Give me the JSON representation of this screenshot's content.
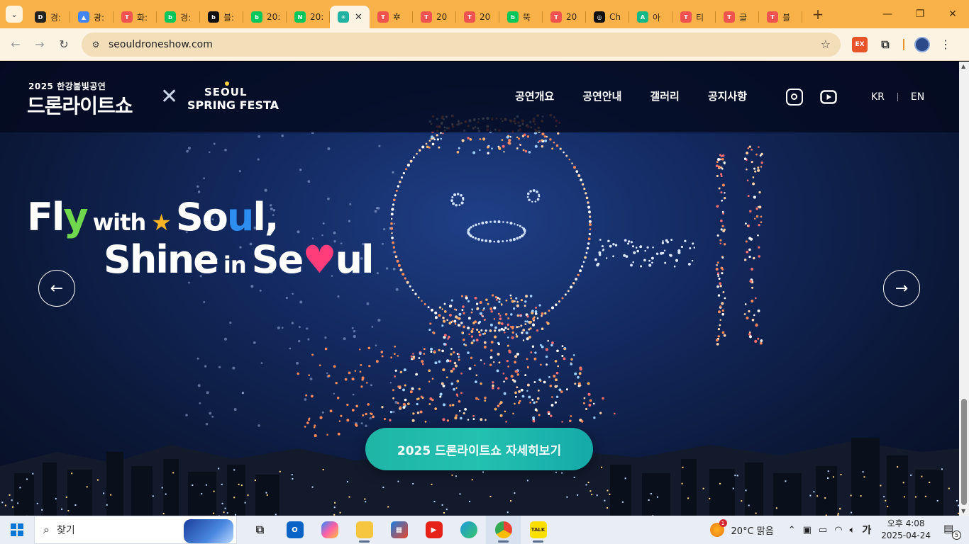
{
  "browser": {
    "tabs": [
      {
        "label": "경:",
        "icon": "d-logo-icon",
        "color": "#222222",
        "glyph": "D"
      },
      {
        "label": "광:",
        "icon": "google-ads-icon",
        "color": "#4285f4",
        "glyph": "▲"
      },
      {
        "label": "화:",
        "icon": "tistory-icon",
        "color": "#ef5350",
        "glyph": "T"
      },
      {
        "label": "경:",
        "icon": "naver-blog-icon",
        "color": "#03c75a",
        "glyph": "b"
      },
      {
        "label": "블:",
        "icon": "b-logo-icon",
        "color": "#111111",
        "glyph": "b"
      },
      {
        "label": "20:",
        "icon": "naver-blog-icon",
        "color": "#03c75a",
        "glyph": "b"
      },
      {
        "label": "20:",
        "icon": "naver-icon",
        "color": "#03c75a",
        "glyph": "N"
      },
      {
        "label": "",
        "icon": "drone-show-icon",
        "color": "#21b3a2",
        "glyph": "✳",
        "active": true
      },
      {
        "label": "",
        "icon": "tistory-icon",
        "color": "#ef5350",
        "glyph": "T",
        "extra": "gear"
      },
      {
        "label": "20",
        "icon": "tistory-icon",
        "color": "#ef5350",
        "glyph": "T"
      },
      {
        "label": "20",
        "icon": "tistory-icon",
        "color": "#ef5350",
        "glyph": "T"
      },
      {
        "label": "뚝",
        "icon": "naver-blog-icon",
        "color": "#03c75a",
        "glyph": "b"
      },
      {
        "label": "20",
        "icon": "tistory-icon",
        "color": "#ef5350",
        "glyph": "T"
      },
      {
        "label": "Ch",
        "icon": "chatgpt-icon",
        "color": "#111111",
        "glyph": "◎"
      },
      {
        "label": "아",
        "icon": "a-logo-icon",
        "color": "#12b886",
        "glyph": "A"
      },
      {
        "label": "티",
        "icon": "tistory-icon",
        "color": "#ef5350",
        "glyph": "T"
      },
      {
        "label": "글",
        "icon": "tistory-icon",
        "color": "#ef5350",
        "glyph": "T"
      },
      {
        "label": "블",
        "icon": "tistory-icon",
        "color": "#ef5350",
        "glyph": "T"
      }
    ],
    "url": "seouldroneshow.com"
  },
  "site": {
    "brand_top": "2025 한강불빛공연",
    "brand_main": "드론라이트쇼",
    "brand_x": "✕",
    "festa_line1": "SEOUL",
    "festa_line2": "SPRING FESTA",
    "menu": [
      "공연개요",
      "공연안내",
      "갤러리",
      "공지사항"
    ],
    "lang_kr": "KR",
    "lang_en": "EN",
    "hero": {
      "fl": "Fl",
      "y": "y",
      "with": "with",
      "so": "So",
      "u1": "u",
      "l_comma": "l,",
      "shine": "Shine",
      "in": "in",
      "se": "Se",
      "heart": "♥",
      "ul": "ul"
    },
    "cta": "2025 드론라이트쇼 자세히보기"
  },
  "taskbar": {
    "search_label": "찾기",
    "weather": "20°C 맑음",
    "weather_badge": "1",
    "ime": "가",
    "time": "오후 4:08",
    "date": "2025-04-24",
    "notif_count": "5"
  }
}
